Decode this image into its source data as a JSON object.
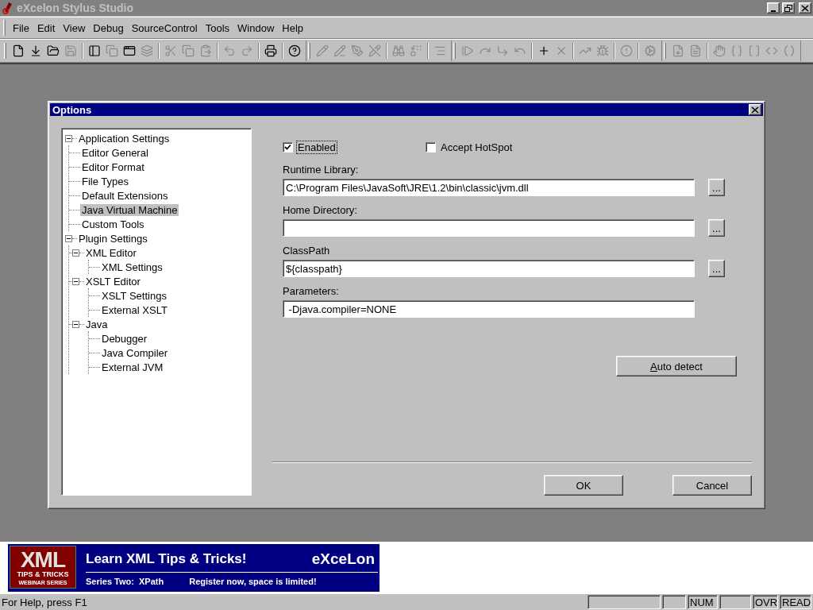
{
  "app": {
    "title": "eXcelon Stylus Studio"
  },
  "menu": [
    {
      "label": "File"
    },
    {
      "label": "Edit"
    },
    {
      "label": "View"
    },
    {
      "label": "Debug"
    },
    {
      "label": "SourceControl"
    },
    {
      "label": "Tools"
    },
    {
      "label": "Window"
    },
    {
      "label": "Help"
    }
  ],
  "toolbar": {
    "bands": [
      {
        "groups": [
          {
            "buttons": [
              {
                "disabled": false
              },
              {
                "disabled": false
              },
              {
                "disabled": false
              },
              {
                "disabled": true
              }
            ]
          },
          {
            "buttons": [
              {
                "disabled": false
              },
              {
                "disabled": true
              },
              {
                "disabled": false
              },
              {
                "disabled": true
              }
            ]
          },
          {
            "buttons": [
              {
                "disabled": true
              },
              {
                "disabled": true
              },
              {
                "disabled": true
              }
            ]
          },
          {
            "buttons": [
              {
                "disabled": true
              },
              {
                "disabled": true
              }
            ]
          },
          {
            "buttons": [
              {
                "disabled": false
              }
            ]
          },
          {
            "buttons": [
              {
                "disabled": false
              }
            ]
          }
        ]
      },
      {
        "groups": [
          {
            "buttons": [
              {
                "disabled": true
              },
              {
                "disabled": true
              },
              {
                "disabled": true
              },
              {
                "disabled": true
              }
            ]
          },
          {
            "buttons": [
              {
                "disabled": true
              },
              {
                "disabled": true
              }
            ]
          },
          {
            "buttons": [
              {
                "disabled": true
              }
            ]
          }
        ]
      },
      {
        "groups": [
          {
            "buttons": [
              {
                "disabled": true
              },
              {
                "disabled": true
              },
              {
                "disabled": true
              },
              {
                "disabled": true
              }
            ]
          },
          {
            "buttons": [
              {
                "disabled": false
              },
              {
                "disabled": true
              }
            ]
          },
          {
            "buttons": [
              {
                "disabled": true
              },
              {
                "disabled": true
              }
            ]
          },
          {
            "buttons": [
              {
                "disabled": true
              }
            ]
          },
          {
            "buttons": [
              {
                "disabled": true
              }
            ]
          }
        ]
      },
      {
        "groups": [
          {
            "buttons": [
              {
                "disabled": true
              },
              {
                "disabled": true
              }
            ]
          },
          {
            "buttons": [
              {
                "disabled": true
              },
              {
                "disabled": true
              },
              {
                "disabled": true
              },
              {
                "disabled": true
              },
              {
                "disabled": true
              }
            ]
          }
        ]
      }
    ]
  },
  "dialog": {
    "title": "Options",
    "tree": [
      {
        "label": "Application Settings",
        "expanded": true,
        "selected": false,
        "children": [
          {
            "label": "Editor General",
            "selected": false
          },
          {
            "label": "Editor Format",
            "selected": false
          },
          {
            "label": "File Types",
            "selected": false
          },
          {
            "label": "Default Extensions",
            "selected": false
          },
          {
            "label": "Java Virtual Machine",
            "selected": true
          },
          {
            "label": "Custom Tools",
            "selected": false
          }
        ]
      },
      {
        "label": "Plugin Settings",
        "expanded": true,
        "selected": false,
        "children": [
          {
            "label": "XML Editor",
            "expanded": true,
            "selected": false,
            "children": [
              {
                "label": "XML Settings",
                "selected": false
              }
            ]
          },
          {
            "label": "XSLT Editor",
            "expanded": true,
            "selected": false,
            "children": [
              {
                "label": "XSLT Settings",
                "selected": false
              },
              {
                "label": "External XSLT",
                "selected": false
              }
            ]
          },
          {
            "label": "Java",
            "expanded": true,
            "selected": false,
            "children": [
              {
                "label": "Debugger",
                "selected": false
              },
              {
                "label": "Java Compiler",
                "selected": false
              },
              {
                "label": "External JVM",
                "selected": false
              }
            ]
          }
        ]
      }
    ],
    "checkboxes": [
      {
        "label": "Enabled",
        "checked": true,
        "focused": true
      },
      {
        "label": "Accept HotSpot",
        "checked": false,
        "focused": false
      }
    ],
    "fields": [
      {
        "label": "Runtime Library:",
        "value": "C:\\Program Files\\JavaSoft\\JRE\\1.2\\bin\\classic\\jvm.dll",
        "browse": "..."
      },
      {
        "label": "Home Directory:",
        "browse": "..."
      },
      {
        "label": "ClassPath",
        "value": "${classpath}",
        "browse": "..."
      },
      {
        "label": "Parameters:",
        "value": " -Djava.compiler=NONE"
      }
    ],
    "auto_detect": "Auto detect",
    "ok": "OK",
    "cancel": "Cancel"
  },
  "banner": {
    "logo_title": "XML",
    "logo_subtitle": "TIPS & TRICKS",
    "logo_series": "WEBINAR SERIES",
    "headline": "Learn XML Tips & Tricks!",
    "brand": "eXceLon",
    "series": "Series Two:  XPath",
    "call": "Register now, space is limited!"
  },
  "status_bar": [
    {
      "kind": "text",
      "text": "For Help, press F1"
    },
    {
      "kind": "blank"
    },
    {
      "kind": "blank"
    },
    {
      "kind": "text",
      "text": "NUM"
    },
    {
      "kind": "blank"
    },
    {
      "kind": "text",
      "text": "OVR"
    },
    {
      "kind": "text",
      "text": "READ"
    }
  ]
}
